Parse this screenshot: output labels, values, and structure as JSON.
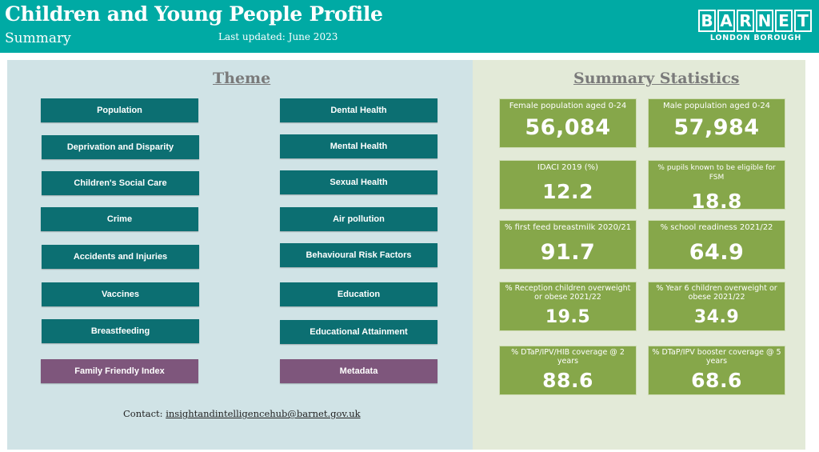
{
  "header": {
    "title": "Children and Young People Profile",
    "subtitle": "Summary",
    "last_updated": "Last updated: June 2023",
    "logo_letters": [
      "B",
      "A",
      "R",
      "N",
      "E",
      "T"
    ],
    "logo_subtitle": "LONDON BOROUGH",
    "color": "#00aaa4"
  },
  "theme": {
    "heading": "Theme",
    "left_buttons": [
      "Population",
      "Deprivation and Disparity",
      "Children's Social Care",
      "Crime",
      "Accidents and Injuries",
      "Vaccines",
      "Breastfeeding",
      "Family Friendly Index"
    ],
    "right_buttons": [
      "Dental Health",
      "Mental Health",
      "Sexual Health",
      "Air pollution",
      "Behavioural Risk Factors",
      "Education",
      "Educational Attainment",
      "Metadata"
    ],
    "button_color": "#0c6f72",
    "alt_button_color": "#7e567c"
  },
  "contact": {
    "label": "Contact:",
    "email": "insightandintelligencehub@barnet.gov.uk"
  },
  "summary": {
    "heading": "Summary Statistics",
    "card_color": "#86a74a",
    "cards": [
      {
        "label": "Female population aged 0-24",
        "value": "56,084"
      },
      {
        "label": "Male population aged 0-24",
        "value": "57,984"
      },
      {
        "label": "IDACI 2019 (%)",
        "value": "12.2"
      },
      {
        "label": "% pupils known to be eligible for FSM",
        "value": "18.8"
      },
      {
        "label": "% first feed breastmilk 2020/21",
        "value": "91.7"
      },
      {
        "label": "% school readiness 2021/22",
        "value": "64.9"
      },
      {
        "label": "% Reception children overweight or obese 2021/22",
        "value": "19.5"
      },
      {
        "label": "% Year 6 children overweight or obese 2021/22",
        "value": "34.9"
      },
      {
        "label": "% DTaP/IPV/HIB coverage @ 2 years",
        "value": "88.6"
      },
      {
        "label": "% DTaP/IPV booster coverage @ 5 years",
        "value": "68.6"
      }
    ]
  }
}
